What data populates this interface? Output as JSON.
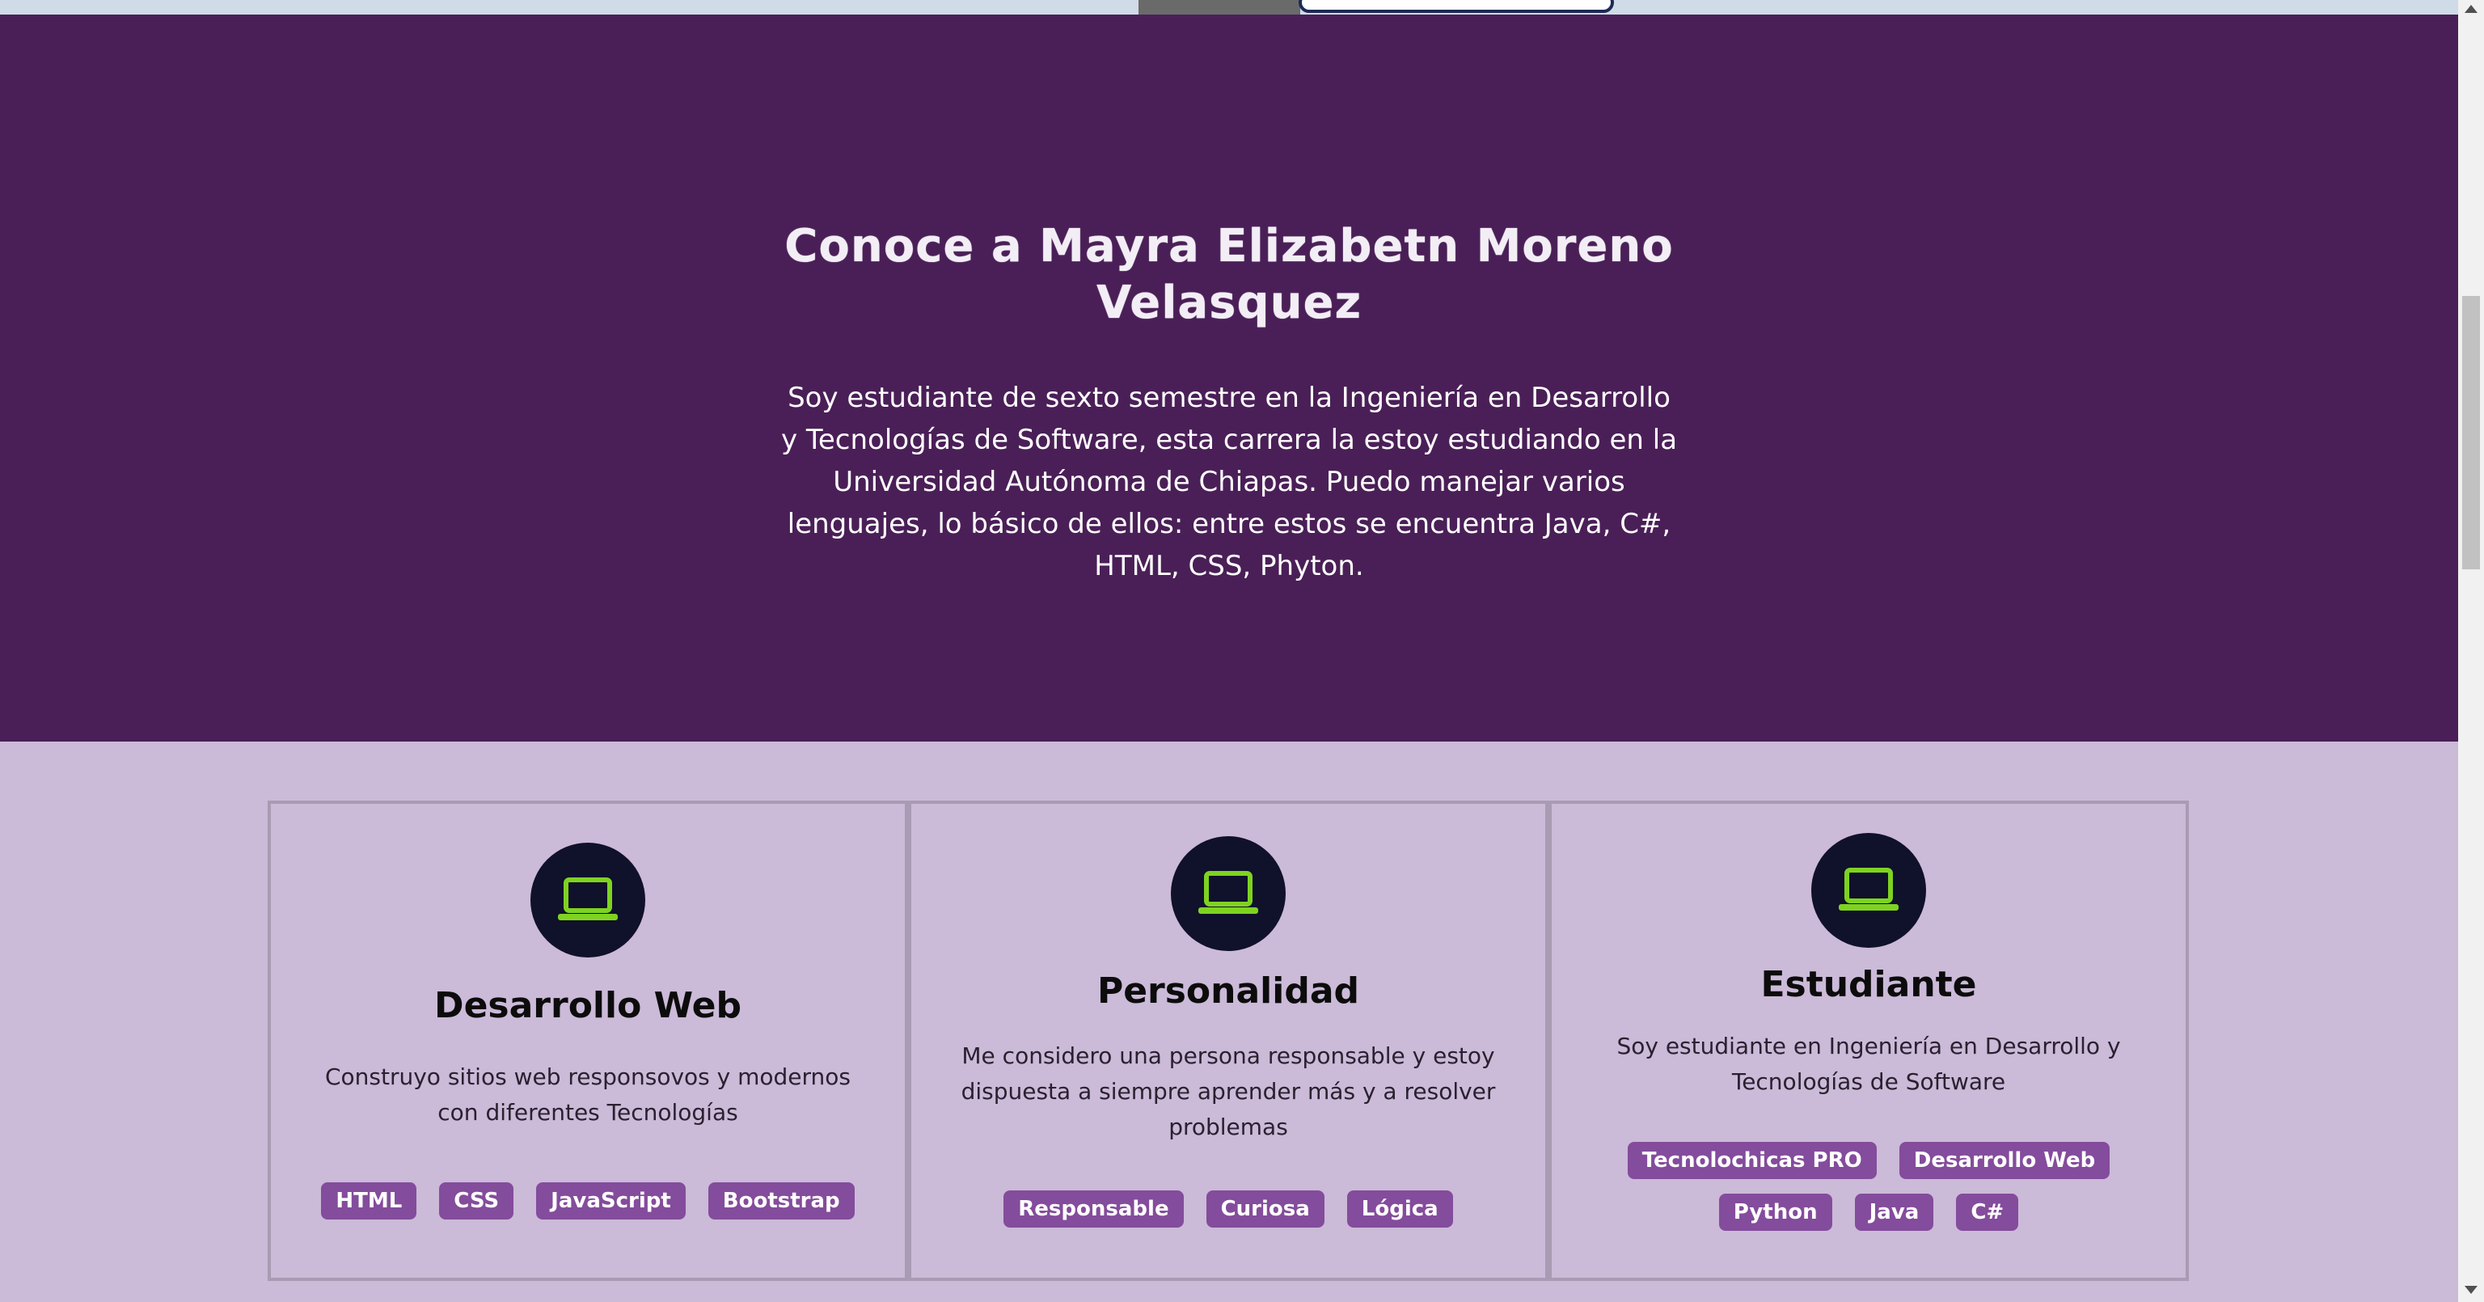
{
  "colors": {
    "hero_bg": "#4a1f57",
    "section_bg": "#cbbad8",
    "icon_circle": "#10112a",
    "icon_accent": "#7ed321",
    "tag_bg": "#844c9c",
    "tag_text": "#ffffff"
  },
  "hero": {
    "title": "Conoce a Mayra Elizabetn Moreno Velasquez",
    "text": "Soy estudiante de sexto semestre en la Ingeniería en Desarrollo y Tecnologías de Software, esta carrera la estoy estudiando en la Universidad Autónoma de Chiapas. Puedo manejar varios lenguajes, lo básico de ellos: entre estos se encuentra Java, C#, HTML, CSS, Phyton."
  },
  "cards": [
    {
      "icon": "laptop-icon",
      "title": "Desarrollo Web",
      "description": "Construyo sitios web responsovos y modernos con diferentes Tecnologías",
      "tags": [
        "HTML",
        "CSS",
        "JavaScript",
        "Bootstrap"
      ]
    },
    {
      "icon": "laptop-icon",
      "title": "Personalidad",
      "description": "Me considero una persona responsable y estoy dispuesta a siempre aprender más y a resolver problemas",
      "tags": [
        "Responsable",
        "Curiosa",
        "Lógica"
      ]
    },
    {
      "icon": "laptop-icon",
      "title": "Estudiante",
      "description": "Soy estudiante en Ingeniería en Desarrollo y Tecnologías de Software",
      "tags": [
        "Tecnolochicas PRO",
        "Desarrollo Web",
        "Python",
        "Java",
        "C#"
      ]
    }
  ]
}
